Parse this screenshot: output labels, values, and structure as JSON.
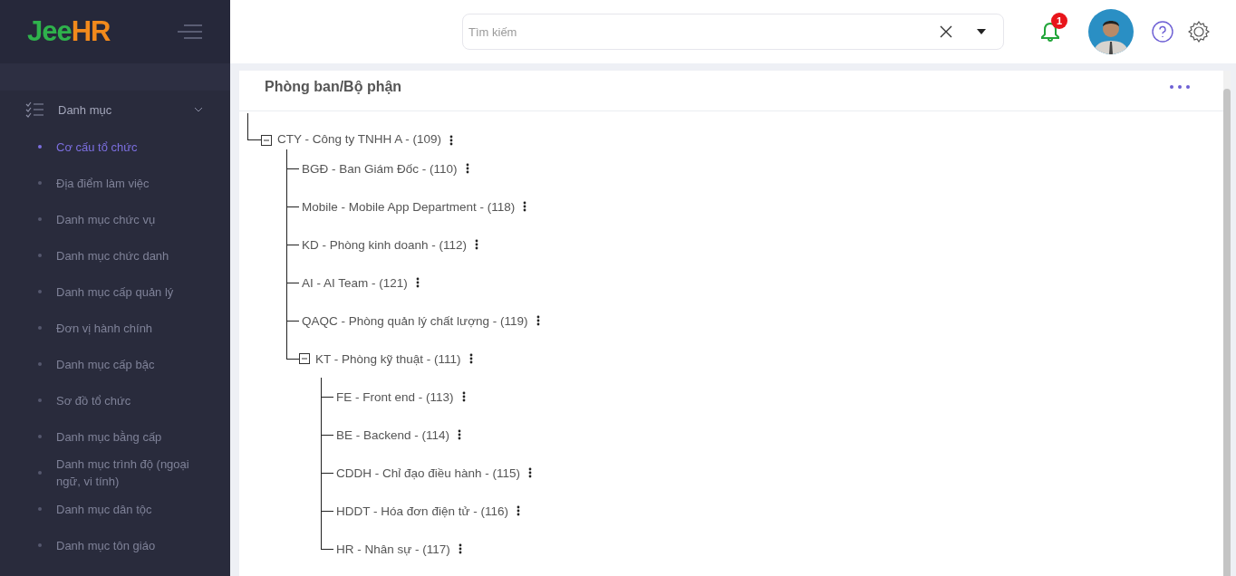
{
  "logo": {
    "part_1": "Jee",
    "part_2": "HR"
  },
  "search": {
    "placeholder": "Tìm kiếm"
  },
  "notifications": {
    "badge": "1"
  },
  "sidebar": {
    "section": {
      "label": "Danh mục",
      "expanded": true
    },
    "items": [
      {
        "label": "Cơ cấu tổ chức",
        "selected": true
      },
      {
        "label": "Địa điểm làm việc",
        "selected": false
      },
      {
        "label": "Danh mục chức vụ",
        "selected": false
      },
      {
        "label": "Danh mục chức danh",
        "selected": false
      },
      {
        "label": "Danh mục cấp quản lý",
        "selected": false
      },
      {
        "label": "Đơn vị hành chính",
        "selected": false
      },
      {
        "label": "Danh mục cấp bậc",
        "selected": false
      },
      {
        "label": "Sơ đồ tổ chức",
        "selected": false
      },
      {
        "label": "Danh mục bằng cấp",
        "selected": false
      },
      {
        "label": "Danh mục trình độ (ngoại ngữ, vi tính)",
        "selected": false
      },
      {
        "label": "Danh mục dân tộc",
        "selected": false
      },
      {
        "label": "Danh mục tôn giáo",
        "selected": false
      }
    ]
  },
  "panel": {
    "title": "Phòng ban/Bộ phận"
  },
  "tree": [
    {
      "label": "CTY - Công ty TNHH A - (109)",
      "expanded": true,
      "children": [
        {
          "label": "BGĐ - Ban Giám Đốc - (110)"
        },
        {
          "label": "Mobile - Mobile App Department - (118)"
        },
        {
          "label": "KD - Phòng kinh doanh - (112)"
        },
        {
          "label": "AI - AI Team - (121)"
        },
        {
          "label": "QAQC - Phòng quản lý chất lượng - (119)"
        },
        {
          "label": "KT - Phòng kỹ thuật - (111)",
          "expanded": true,
          "children": [
            {
              "label": "FE - Front end - (113)"
            },
            {
              "label": "BE - Backend - (114)"
            },
            {
              "label": "CDDH - Chỉ đạo điều hành - (115)"
            },
            {
              "label": "HDDT - Hóa đơn điện tử - (116)"
            },
            {
              "label": "HR - Nhân sự - (117)"
            }
          ]
        }
      ]
    }
  ]
}
